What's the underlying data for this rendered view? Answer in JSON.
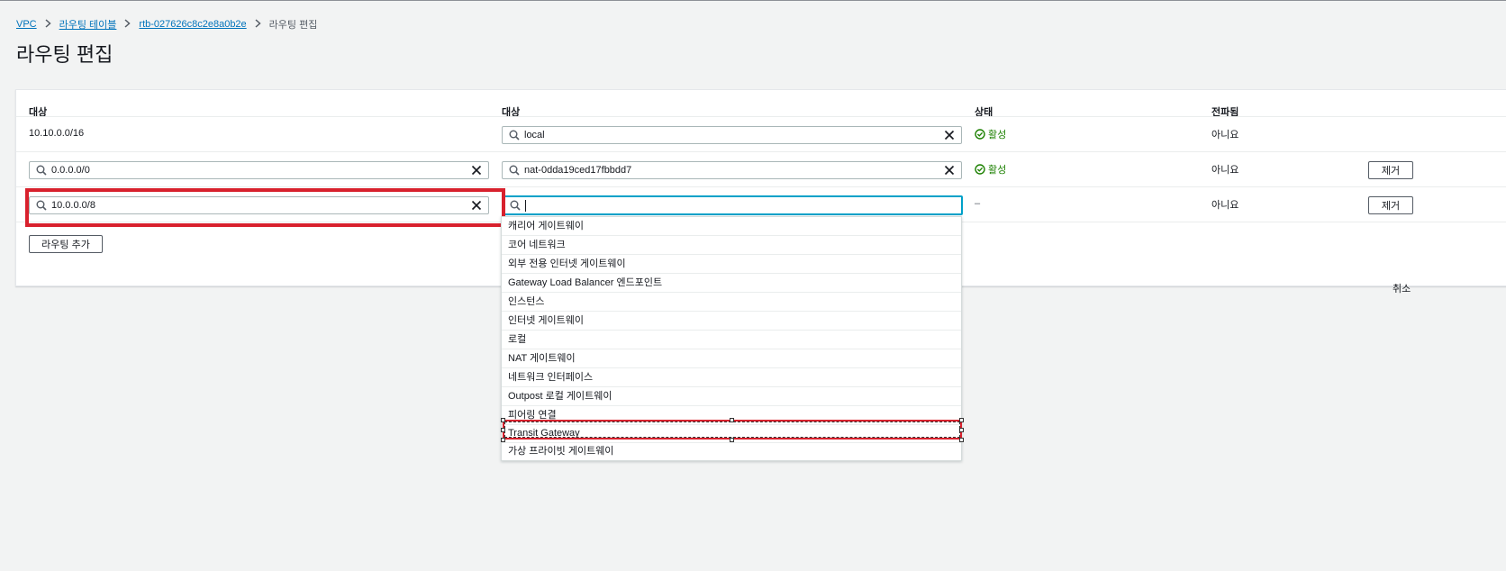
{
  "breadcrumb": {
    "vpc": "VPC",
    "route_tables": "라우팅 테이블",
    "rtb_id": "rtb-027626c8c2e8a0b2e",
    "current": "라우팅 편집"
  },
  "page": {
    "title": "라우팅 편집"
  },
  "table": {
    "headers": {
      "destination": "대상",
      "target": "대상",
      "status": "상태",
      "propagated": "전파됨"
    },
    "rows": [
      {
        "destination": "10.10.0.0/16",
        "target": "local",
        "status": "활성",
        "propagated": "아니요"
      },
      {
        "destination": "0.0.0.0/0",
        "target": "nat-0dda19ced17fbbdd7",
        "status": "활성",
        "propagated": "아니요",
        "remove_label": "제거"
      },
      {
        "destination": "10.0.0.0/8",
        "target": "",
        "status": "–",
        "propagated": "아니요",
        "remove_label": "제거"
      }
    ]
  },
  "add_route_label": "라우팅 추가",
  "cancel_label": "취소",
  "dropdown": {
    "options": [
      "캐리어 게이트웨이",
      "코어 네트워크",
      "외부 전용 인터넷 게이트웨이",
      "Gateway Load Balancer 엔드포인트",
      "인스턴스",
      "인터넷 게이트웨이",
      "로컬",
      "NAT 게이트웨이",
      "네트워크 인터페이스",
      "Outpost 로컬 게이트웨이",
      "피어링 연결",
      "Transit Gateway",
      "가상 프라이빗 게이트웨이"
    ]
  },
  "colors": {
    "link": "#0073bb",
    "success": "#1d8102",
    "highlight": "#d8212d",
    "focus": "#00a1c9"
  },
  "icons": [
    "chevron-right-icon",
    "search-icon",
    "clear-icon",
    "status-success-icon"
  ]
}
